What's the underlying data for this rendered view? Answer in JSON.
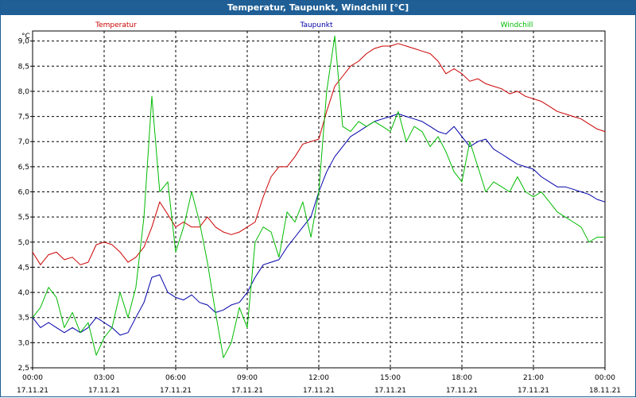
{
  "window": {
    "title": "Temperatur, Taupunkt, Windchill [°C]"
  },
  "chart_data": {
    "type": "line",
    "title": "Temperatur, Taupunkt, Windchill [°C]",
    "ylabel": "°C",
    "ylim": [
      2.5,
      9.2
    ],
    "yticks": [
      "2,5",
      "3,0",
      "3,5",
      "4,0",
      "4,5",
      "5,0",
      "5,5",
      "6,0",
      "6,5",
      "7,0",
      "7,5",
      "8,0",
      "8,5",
      "9,0"
    ],
    "xlim": [
      0,
      24
    ],
    "xticks": [
      {
        "time": "00:00",
        "date": "17.11.21"
      },
      {
        "time": "03:00",
        "date": "17.11.21"
      },
      {
        "time": "06:00",
        "date": "17.11.21"
      },
      {
        "time": "09:00",
        "date": "17.11.21"
      },
      {
        "time": "12:00",
        "date": "17.11.21"
      },
      {
        "time": "15:00",
        "date": "17.11.21"
      },
      {
        "time": "18:00",
        "date": "17.11.21"
      },
      {
        "time": "21:00",
        "date": "17.11.21"
      },
      {
        "time": "00:00",
        "date": "18.11.21"
      }
    ],
    "grid": true,
    "legend": "top",
    "series": [
      {
        "name": "Temperatur",
        "color": "#cc0000",
        "x": [
          0,
          0.33,
          0.67,
          1,
          1.33,
          1.67,
          2,
          2.33,
          2.67,
          3,
          3.33,
          3.67,
          4,
          4.33,
          4.67,
          5,
          5.33,
          5.67,
          6,
          6.33,
          6.67,
          7,
          7.33,
          7.67,
          8,
          8.33,
          8.67,
          9,
          9.33,
          9.67,
          10,
          10.33,
          10.67,
          11,
          11.33,
          11.67,
          12,
          12.33,
          12.67,
          13,
          13.33,
          13.67,
          14,
          14.33,
          14.67,
          15,
          15.33,
          15.67,
          16,
          16.33,
          16.67,
          17,
          17.33,
          17.67,
          18,
          18.33,
          18.67,
          19,
          19.33,
          19.67,
          20,
          20.33,
          20.67,
          21,
          21.33,
          21.67,
          22,
          22.33,
          22.67,
          23,
          23.33,
          23.67,
          24
        ],
        "y": [
          4.8,
          4.55,
          4.75,
          4.8,
          4.65,
          4.7,
          4.55,
          4.6,
          4.95,
          5.0,
          4.95,
          4.8,
          4.6,
          4.7,
          4.9,
          5.3,
          5.8,
          5.55,
          5.3,
          5.4,
          5.3,
          5.3,
          5.5,
          5.3,
          5.2,
          5.15,
          5.2,
          5.3,
          5.4,
          5.9,
          6.3,
          6.5,
          6.5,
          6.7,
          6.95,
          7.0,
          7.05,
          7.6,
          8.1,
          8.3,
          8.5,
          8.6,
          8.75,
          8.85,
          8.9,
          8.9,
          8.95,
          8.9,
          8.85,
          8.8,
          8.75,
          8.6,
          8.35,
          8.45,
          8.35,
          8.2,
          8.25,
          8.15,
          8.1,
          8.05,
          7.95,
          8.0,
          7.9,
          7.85,
          7.8,
          7.7,
          7.6,
          7.55,
          7.5,
          7.45,
          7.35,
          7.25,
          7.2
        ]
      },
      {
        "name": "Taupunkt",
        "color": "#0000aa",
        "x": [
          0,
          0.33,
          0.67,
          1,
          1.33,
          1.67,
          2,
          2.33,
          2.67,
          3,
          3.33,
          3.67,
          4,
          4.33,
          4.67,
          5,
          5.33,
          5.67,
          6,
          6.33,
          6.67,
          7,
          7.33,
          7.67,
          8,
          8.33,
          8.67,
          9,
          9.33,
          9.67,
          10,
          10.33,
          10.67,
          11,
          11.33,
          11.67,
          12,
          12.33,
          12.67,
          13,
          13.33,
          13.67,
          14,
          14.33,
          14.67,
          15,
          15.33,
          15.67,
          16,
          16.33,
          16.67,
          17,
          17.33,
          17.67,
          18,
          18.33,
          18.67,
          19,
          19.33,
          19.67,
          20,
          20.33,
          20.67,
          21,
          21.33,
          21.67,
          22,
          22.33,
          22.67,
          23,
          23.33,
          23.67,
          24
        ],
        "y": [
          3.5,
          3.3,
          3.4,
          3.3,
          3.2,
          3.3,
          3.2,
          3.3,
          3.5,
          3.4,
          3.3,
          3.15,
          3.2,
          3.5,
          3.8,
          4.3,
          4.35,
          4.0,
          3.9,
          3.85,
          3.95,
          3.8,
          3.75,
          3.6,
          3.65,
          3.75,
          3.8,
          4.0,
          4.3,
          4.55,
          4.6,
          4.65,
          4.9,
          5.1,
          5.3,
          5.5,
          6.0,
          6.4,
          6.7,
          6.9,
          7.1,
          7.2,
          7.3,
          7.4,
          7.45,
          7.5,
          7.55,
          7.5,
          7.45,
          7.4,
          7.3,
          7.2,
          7.15,
          7.3,
          7.1,
          6.9,
          7.0,
          7.05,
          6.85,
          6.75,
          6.65,
          6.55,
          6.5,
          6.45,
          6.3,
          6.2,
          6.1,
          6.1,
          6.05,
          6.0,
          5.95,
          5.85,
          5.8
        ]
      },
      {
        "name": "Windchill",
        "color": "#00bb00",
        "x": [
          0,
          0.33,
          0.67,
          1,
          1.33,
          1.67,
          2,
          2.33,
          2.67,
          3,
          3.33,
          3.67,
          4,
          4.33,
          4.67,
          5,
          5.33,
          5.67,
          6,
          6.33,
          6.67,
          7,
          7.33,
          7.67,
          8,
          8.33,
          8.67,
          9,
          9.33,
          9.67,
          10,
          10.33,
          10.67,
          11,
          11.33,
          11.67,
          12,
          12.33,
          12.67,
          13,
          13.33,
          13.67,
          14,
          14.33,
          14.67,
          15,
          15.33,
          15.67,
          16,
          16.33,
          16.67,
          17,
          17.33,
          17.67,
          18,
          18.33,
          18.67,
          19,
          19.33,
          19.67,
          20,
          20.33,
          20.67,
          21,
          21.33,
          21.67,
          22,
          22.33,
          22.67,
          23,
          23.33,
          23.67,
          24
        ],
        "y": [
          3.5,
          3.7,
          4.1,
          3.9,
          3.3,
          3.6,
          3.2,
          3.4,
          2.75,
          3.1,
          3.3,
          4.0,
          3.5,
          4.1,
          5.5,
          7.9,
          6.0,
          6.2,
          4.8,
          5.3,
          6.0,
          5.4,
          4.6,
          3.6,
          2.7,
          3.0,
          3.7,
          3.3,
          5.0,
          5.3,
          5.2,
          4.7,
          5.6,
          5.4,
          5.8,
          5.1,
          6.0,
          8.0,
          9.1,
          7.3,
          7.2,
          7.4,
          7.3,
          7.4,
          7.3,
          7.2,
          7.6,
          7.0,
          7.3,
          7.2,
          6.9,
          7.1,
          6.8,
          6.4,
          6.2,
          7.0,
          6.5,
          6.0,
          6.2,
          6.1,
          6.0,
          6.3,
          6.0,
          5.9,
          6.0,
          5.8,
          5.6,
          5.5,
          5.4,
          5.3,
          5.0,
          5.1,
          5.1
        ]
      }
    ]
  }
}
